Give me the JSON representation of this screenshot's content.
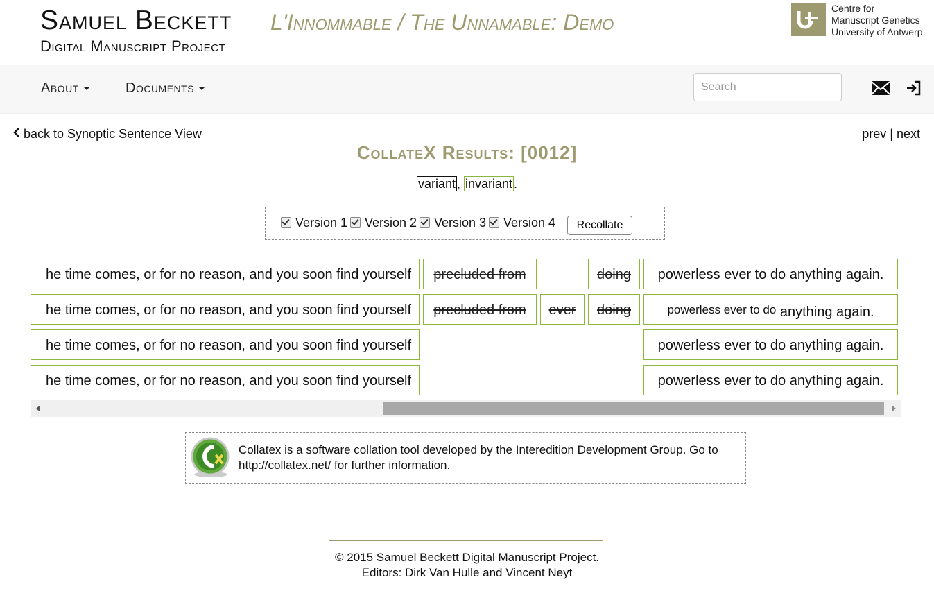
{
  "header": {
    "title": "Samuel Beckett",
    "subtitle": "L'Innommable / The Unnamable: Demo",
    "project": "Digital Manuscript Project",
    "partner_lines": [
      "Centre for",
      "Manuscript Genetics",
      "University of Antwerp"
    ]
  },
  "nav": {
    "about_label": "About",
    "documents_label": "Documents",
    "search_placeholder": "Search",
    "icons": [
      "envelope-icon",
      "sign-in-icon"
    ]
  },
  "subnav": {
    "back_label": "back to Synoptic Sentence View",
    "prev_label": "prev",
    "separator": "|",
    "next_label": "next"
  },
  "page": {
    "title": "CollateX Results: [0012]",
    "legend_variant": "variant",
    "legend_sep": ", ",
    "legend_invariant": "invariant",
    "legend_end": "."
  },
  "versions": {
    "items": [
      {
        "label": "Version 1",
        "checked": true
      },
      {
        "label": "Version 2",
        "checked": true
      },
      {
        "label": "Version 3",
        "checked": true
      },
      {
        "label": "Version 4",
        "checked": true
      }
    ],
    "recollate_label": "Recollate"
  },
  "collation": {
    "rows": [
      {
        "lead": "he time comes, or for no reason, and you soon find yourself",
        "c1": "precluded from",
        "c2": "",
        "c3": "doing",
        "tail_small": "",
        "tail": "powerless ever to do anything again."
      },
      {
        "lead": "he time comes, or for no reason, and you soon find yourself",
        "c1": "precluded from",
        "c2": "ever",
        "c3": "doing",
        "tail_small": "powerless ever to do",
        "tail": "anything again."
      },
      {
        "lead": "he time comes, or for no reason, and you soon find yourself",
        "c1": "",
        "c2": "",
        "c3": "",
        "tail_small": "",
        "tail": "powerless ever to do anything again."
      },
      {
        "lead": "he time comes, or for no reason, and you soon find yourself",
        "c1": "",
        "c2": "",
        "c3": "",
        "tail_small": "",
        "tail": "powerless ever to do anything again."
      }
    ]
  },
  "info": {
    "text_before": "Collatex is a software collation tool developed by the Interedition Development Group. Go to ",
    "link": "http://collatex.net/",
    "text_after": " for further information."
  },
  "footer": {
    "line1": "© 2015 Samuel Beckett Digital Manuscript Project.",
    "line2": "Editors: Dirk Van Hulle and Vincent Neyt"
  },
  "colors": {
    "accent": "#9c9a6e",
    "invariant_border": "#8ab83a",
    "variant_border": "#111111"
  }
}
